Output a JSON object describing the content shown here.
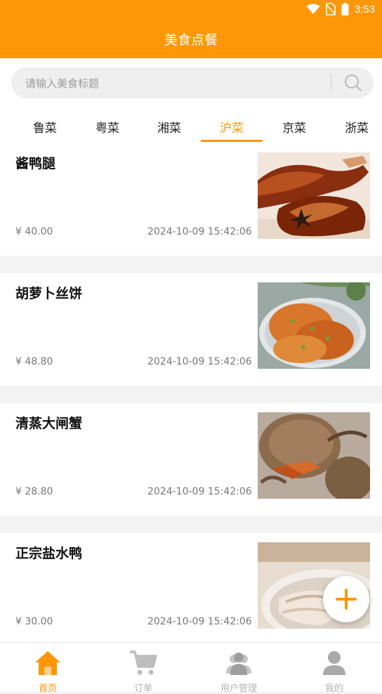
{
  "status_bar": {
    "time": "3:53"
  },
  "app_bar": {
    "title": "美食点餐"
  },
  "search": {
    "placeholder": "请输入美食标题"
  },
  "tabs": [
    {
      "label": "鲁菜"
    },
    {
      "label": "粤菜"
    },
    {
      "label": "湘菜"
    },
    {
      "label": "沪菜"
    },
    {
      "label": "京菜"
    },
    {
      "label": "浙菜"
    }
  ],
  "active_tab": "沪菜",
  "dishes": [
    {
      "title": "酱鸭腿",
      "price": "¥ 40.00",
      "date": "2024-10-09 15:42:06"
    },
    {
      "title": "胡萝卜丝饼",
      "price": "¥ 48.80",
      "date": "2024-10-09 15:42:06"
    },
    {
      "title": "清蒸大闸蟹",
      "price": "¥ 28.80",
      "date": "2024-10-09 15:42:06"
    },
    {
      "title": "正宗盐水鸭",
      "price": "¥ 30.00",
      "date": "2024-10-09 15:42:06"
    }
  ],
  "bottom_nav": [
    {
      "label": "首页",
      "icon": "home-icon",
      "active": true
    },
    {
      "label": "订单",
      "icon": "cart-icon",
      "active": false
    },
    {
      "label": "用户管理",
      "icon": "users-icon",
      "active": false
    },
    {
      "label": "我的",
      "icon": "profile-icon",
      "active": false
    }
  ],
  "colors": {
    "accent": "#fd9708",
    "inactive_nav": "#b4b4b4",
    "page_background": "#f3f3f3"
  }
}
